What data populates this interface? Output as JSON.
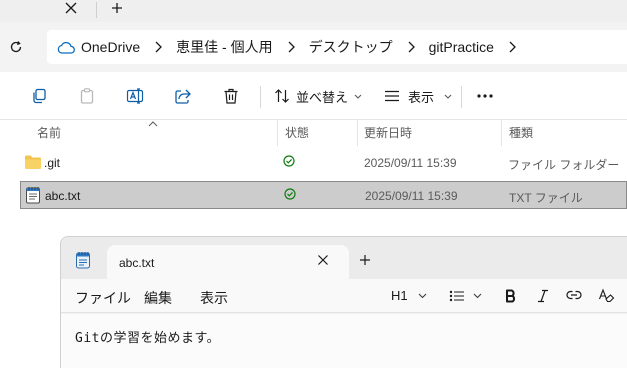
{
  "explorer": {
    "address": {
      "crumbs": [
        "OneDrive",
        "恵里佳 - 個人用",
        "デスクトップ",
        "gitPractice"
      ]
    },
    "toolbar": {
      "sort_label": "並べ替え",
      "view_label": "表示",
      "more_label": "..."
    },
    "columns": {
      "name": "名前",
      "status": "状態",
      "modified": "更新日時",
      "type": "種類"
    },
    "files": [
      {
        "name": ".git",
        "modified": "2025/09/11 15:39",
        "type": "ファイル フォルダー",
        "selected": false
      },
      {
        "name": "abc.txt",
        "modified": "2025/09/11 15:39",
        "type": "TXT ファイル",
        "selected": true
      }
    ],
    "colors": {
      "status_synced": "#107c10",
      "folder": "#f0c54e",
      "accent": "#0067c0"
    }
  },
  "notepad": {
    "tab_title": "abc.txt",
    "menu": {
      "file": "ファイル",
      "edit": "編集",
      "view": "表示"
    },
    "toolbar": {
      "heading": "H1"
    },
    "content": "Gitの学習を始めます。"
  }
}
